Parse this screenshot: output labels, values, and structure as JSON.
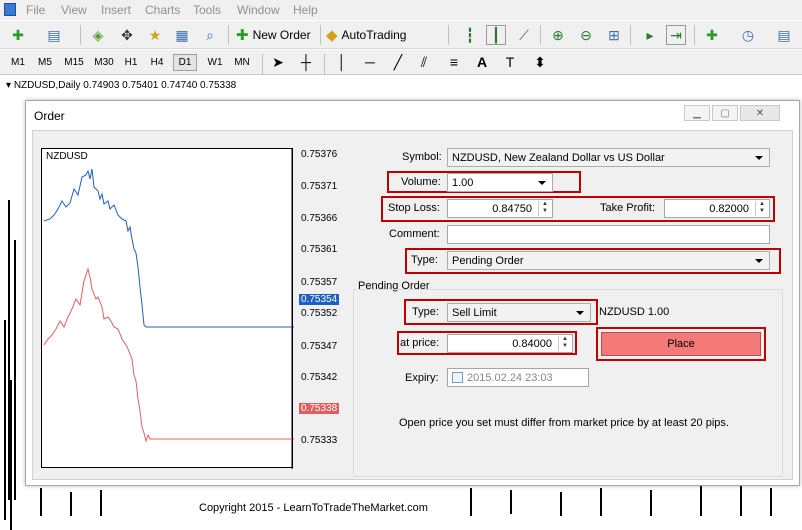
{
  "menu": {
    "items": [
      "File",
      "View",
      "Insert",
      "Charts",
      "Tools",
      "Window",
      "Help"
    ]
  },
  "toolbar": {
    "new_order_label": "New Order",
    "autotrading_label": "AutoTrading"
  },
  "timeframes": {
    "items": [
      "M1",
      "M5",
      "M15",
      "M30",
      "H1",
      "H4",
      "D1",
      "W1",
      "MN"
    ],
    "active": "D1"
  },
  "chart_header": {
    "text": "NZDUSD,Daily  0.74903 0.75401 0.74740 0.75338"
  },
  "dialog": {
    "title": "Order",
    "mini_chart": {
      "symbol": "NZDUSD",
      "price_labels": [
        "0.75376",
        "0.75371",
        "0.75366",
        "0.75361",
        "0.75357",
        "0.75352",
        "0.75347",
        "0.75342",
        "0.75338",
        "0.75333"
      ],
      "ask_tag": "0.75354",
      "bid_tag": "0.75338",
      "ask_color": "#1f5fbf",
      "bid_color": "#e06060"
    },
    "symbol_label": "Symbol:",
    "symbol_value": "NZDUSD, New Zealand Dollar vs US Dollar",
    "volume_label": "Volume:",
    "volume_value": "1.00",
    "stop_loss_label": "Stop Loss:",
    "stop_loss_value": "0.84750",
    "take_profit_label": "Take Profit:",
    "take_profit_value": "0.82000",
    "comment_label": "Comment:",
    "comment_value": "",
    "type_label": "Type:",
    "type_value": "Pending Order",
    "pending": {
      "group_label": "Pending Order",
      "type_label": "Type:",
      "type_value": "Sell Limit",
      "info": "NZDUSD 1.00",
      "at_price_label": "at price:",
      "at_price_value": "0.84000",
      "place_label": "Place",
      "expiry_label": "Expiry:",
      "expiry_value": "2015.02.24 23:03",
      "note": "Open price you set must differ from market price by at least 20 pips."
    },
    "highlight_color": "#c00000",
    "place_color": "#f47a7a"
  },
  "footer": {
    "copyright": "Copyright 2015 - LearnToTradeTheMarket.com"
  }
}
